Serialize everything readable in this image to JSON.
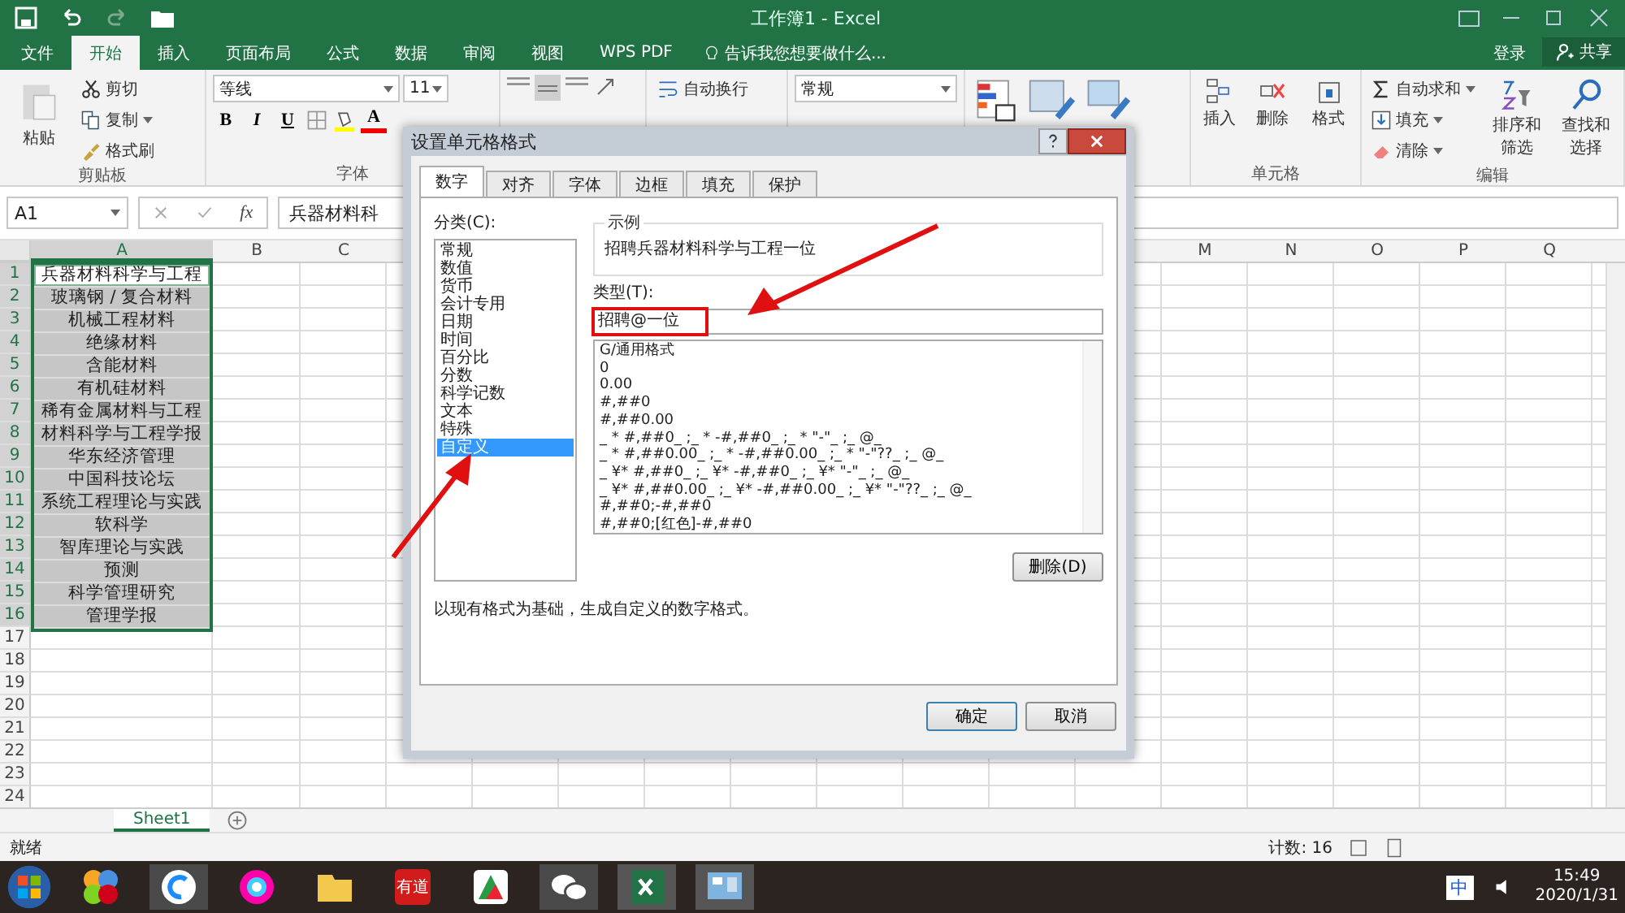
{
  "title_bar": {
    "title": "工作簿1 - Excel"
  },
  "menu_tabs": [
    {
      "label": "文件",
      "selected": false
    },
    {
      "label": "开始",
      "selected": true
    },
    {
      "label": "插入",
      "selected": false
    },
    {
      "label": "页面布局",
      "selected": false
    },
    {
      "label": "公式",
      "selected": false
    },
    {
      "label": "数据",
      "selected": false
    },
    {
      "label": "审阅",
      "selected": false
    },
    {
      "label": "视图",
      "selected": false
    },
    {
      "label": "WPS PDF",
      "selected": false
    }
  ],
  "tell_me": "告诉我您想要做什么...",
  "account": {
    "sign_in": "登录",
    "share": "共享"
  },
  "ribbon": {
    "clipboard": {
      "paste": "粘贴",
      "cut": "剪切",
      "copy": "复制",
      "format_painter": "格式刷",
      "label": "剪贴板"
    },
    "font": {
      "name": "等线",
      "size": "11",
      "bold": "B",
      "italic": "I",
      "underline": "U",
      "font_color": "A",
      "label": "字体"
    },
    "wrap_text": "自动换行",
    "number_format": "常规",
    "cells": {
      "insert": "插入",
      "delete": "删除",
      "format": "格式",
      "label": "单元格"
    },
    "editing": {
      "autosum": "自动求和",
      "fill": "填充",
      "clear": "清除",
      "sort_filter": "排序和筛选",
      "find_select": "查找和选择",
      "label": "编辑"
    }
  },
  "formula_bar": {
    "name_box": "A1",
    "fx": "fx",
    "content": "兵器材料科"
  },
  "sheet": {
    "columns_left": [
      {
        "label": "A",
        "selected": true
      },
      {
        "label": "B",
        "selected": false
      },
      {
        "label": "C",
        "selected": false
      }
    ],
    "columns_right": [
      {
        "label": "M",
        "selected": false
      },
      {
        "label": "N",
        "selected": false
      },
      {
        "label": "O",
        "selected": false
      },
      {
        "label": "P",
        "selected": false
      },
      {
        "label": "Q",
        "selected": false
      }
    ],
    "rows": [
      {
        "number": "1",
        "a": "兵器材料科学与工程",
        "selected": true,
        "active": true
      },
      {
        "number": "2",
        "a": "玻璃钢 / 复合材料",
        "selected": true,
        "active": false
      },
      {
        "number": "3",
        "a": "机械工程材料",
        "selected": true,
        "active": false
      },
      {
        "number": "4",
        "a": "绝缘材料",
        "selected": true,
        "active": false
      },
      {
        "number": "5",
        "a": "含能材料",
        "selected": true,
        "active": false
      },
      {
        "number": "6",
        "a": "有机硅材料",
        "selected": true,
        "active": false
      },
      {
        "number": "7",
        "a": "稀有金属材料与工程",
        "selected": true,
        "active": false
      },
      {
        "number": "8",
        "a": "材料科学与工程学报",
        "selected": true,
        "active": false
      },
      {
        "number": "9",
        "a": "华东经济管理",
        "selected": true,
        "active": false
      },
      {
        "number": "10",
        "a": "中国科技论坛",
        "selected": true,
        "active": false
      },
      {
        "number": "11",
        "a": "系统工程理论与实践",
        "selected": true,
        "active": false
      },
      {
        "number": "12",
        "a": "软科学",
        "selected": true,
        "active": false
      },
      {
        "number": "13",
        "a": "智库理论与实践",
        "selected": true,
        "active": false
      },
      {
        "number": "14",
        "a": "预测",
        "selected": true,
        "active": false
      },
      {
        "number": "15",
        "a": "科学管理研究",
        "selected": true,
        "active": false
      },
      {
        "number": "16",
        "a": "管理学报",
        "selected": true,
        "active": false
      },
      {
        "number": "17",
        "selected": false,
        "active": false
      },
      {
        "number": "18",
        "selected": false,
        "active": false
      },
      {
        "number": "19",
        "selected": false,
        "active": false
      },
      {
        "number": "20",
        "selected": false,
        "active": false
      },
      {
        "number": "21",
        "selected": false,
        "active": false
      },
      {
        "number": "22",
        "selected": false,
        "active": false
      },
      {
        "number": "23",
        "selected": false,
        "active": false
      },
      {
        "number": "24",
        "selected": false,
        "active": false
      }
    ]
  },
  "sheet_tabs": [
    {
      "label": "Sheet1",
      "selected": true
    }
  ],
  "status_bar": {
    "ready": "就绪",
    "count": "计数: 16"
  },
  "dialog": {
    "title": "设置单元格格式",
    "tabs": [
      {
        "label": "数字",
        "selected": true
      },
      {
        "label": "对齐",
        "selected": false
      },
      {
        "label": "字体",
        "selected": false
      },
      {
        "label": "边框",
        "selected": false
      },
      {
        "label": "填充",
        "selected": false
      },
      {
        "label": "保护",
        "selected": false
      }
    ],
    "category_label": "分类(C):",
    "categories": [
      {
        "label": "常规",
        "selected": false
      },
      {
        "label": "数值",
        "selected": false
      },
      {
        "label": "货币",
        "selected": false
      },
      {
        "label": "会计专用",
        "selected": false
      },
      {
        "label": "日期",
        "selected": false
      },
      {
        "label": "时间",
        "selected": false
      },
      {
        "label": "百分比",
        "selected": false
      },
      {
        "label": "分数",
        "selected": false
      },
      {
        "label": "科学记数",
        "selected": false
      },
      {
        "label": "文本",
        "selected": false
      },
      {
        "label": "特殊",
        "selected": false
      },
      {
        "label": "自定义",
        "selected": true
      }
    ],
    "sample_label": "示例",
    "sample": "招聘兵器材料科学与工程一位",
    "type_label": "类型(T):",
    "type_value": "招聘@一位",
    "formats": [
      "G/通用格式",
      "0",
      "0.00",
      "#,##0",
      "#,##0.00",
      "_ * #,##0_ ;_ * -#,##0_ ;_ * \"-\"_ ;_ @_",
      "_ * #,##0.00_ ;_ * -#,##0.00_ ;_ * \"-\"??_ ;_ @_",
      "_ ¥* #,##0_ ;_ ¥* -#,##0_ ;_ ¥* \"-\"_ ;_ @_",
      "_ ¥* #,##0.00_ ;_ ¥* -#,##0.00_ ;_ ¥* \"-\"??_ ;_ @_",
      "#,##0;-#,##0",
      "#,##0;[红色]-#,##0"
    ],
    "delete": "删除(D)",
    "description": "以现有格式为基础，生成自定义的数字格式。",
    "ok": "确定",
    "cancel": "取消"
  },
  "taskbar": {
    "youdao": "有道",
    "ime": "中",
    "time": "15:49",
    "date": "2020/1/31"
  }
}
